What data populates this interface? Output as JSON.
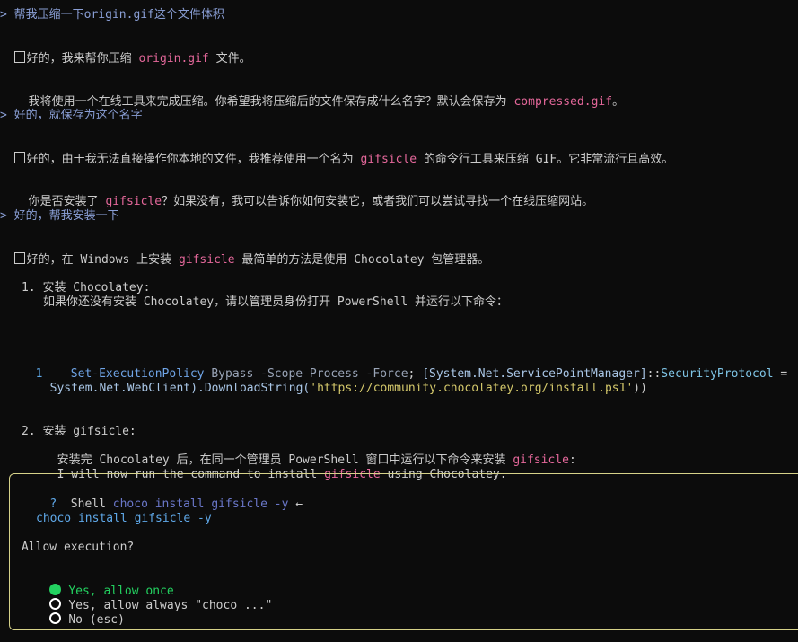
{
  "conversation": {
    "user1": "> 帮我压缩一下origin.gif这个文件体积",
    "a1_pre": "好的，我来帮你压缩 ",
    "a1_file": "origin.gif",
    "a1_post": " 文件。",
    "a1_q_pre": "我将使用一个在线工具来完成压缩。你希望我将压缩后的文件保存成什么名字？默认会保存为 ",
    "a1_q_file": "compressed.gif",
    "a1_q_post": "。",
    "user2": "> 好的，就保存为这个名字",
    "a2_pre": "好的，由于我无法直接操作你本地的文件，我推荐使用一个名为 ",
    "a2_tool": "gifsicle",
    "a2_post": " 的命令行工具来压缩 GIF。它非常流行且高效。",
    "a2_q_pre": "你是否安装了 ",
    "a2_q_tool": "gifsicle",
    "a2_q_post": "？如果没有，我可以告诉你如何安装它，或者我们可以尝试寻找一个在线压缩网站。",
    "user3": "> 好的，帮我安装一下",
    "a3_pre": "好的，在 Windows 上安装 ",
    "a3_tool": "gifsicle",
    "a3_post": " 最简单的方法是使用 Chocolatey 包管理器。",
    "step1_title": "1. 安装 Chocolatey:",
    "step1_desc": "如果你还没有安装 Chocolatey，请以管理员身份打开 PowerShell 并运行以下命令：",
    "code_line_no": "1",
    "code_cmd": "Set-ExecutionPolicy",
    "code_arg1": " Bypass",
    "code_p1": " -Scope",
    "code_arg2": " Process",
    "code_p2": " -Force",
    "code_semi": "; ",
    "code_type": "[System.Net.ServicePointManager]",
    "code_sep": "::",
    "code_member": "SecurityProtocol",
    "code_tail": " =",
    "code_line2_pre": "System.Net.WebClient).DownloadString(",
    "code_url": "'https://community.chocolatey.org/install.ps1'",
    "code_line2_post": "))",
    "step2_title": "2. 安装 gifsicle:",
    "step2_desc_pre": "安装完 Chocolatey 后，在同一个管理员 PowerShell 窗口中运行以下命令来安装 ",
    "step2_desc_tool": "gifsicle",
    "step2_desc_post": ":",
    "step2_en_pre": "I will now run the command to install ",
    "step2_en_tool": "gifsicle",
    "step2_en_post": " using Chocolatey."
  },
  "dialog": {
    "q_mark": "?",
    "shell_label": "Shell",
    "shell_cmd": "choco install gifsicle -y",
    "arrow": "←",
    "command": "choco install gifsicle -y",
    "question": "Allow execution?",
    "options": [
      {
        "label": "Yes, allow once",
        "selected": true
      },
      {
        "label": "Yes, allow always \"choco ...\"",
        "selected": false
      },
      {
        "label": "No (esc)",
        "selected": false
      }
    ]
  },
  "colors": {
    "prompt": "#8a9fd6",
    "code_inline": "#e5689b",
    "dialog_border": "#d6d289",
    "selected": "#23d160"
  }
}
